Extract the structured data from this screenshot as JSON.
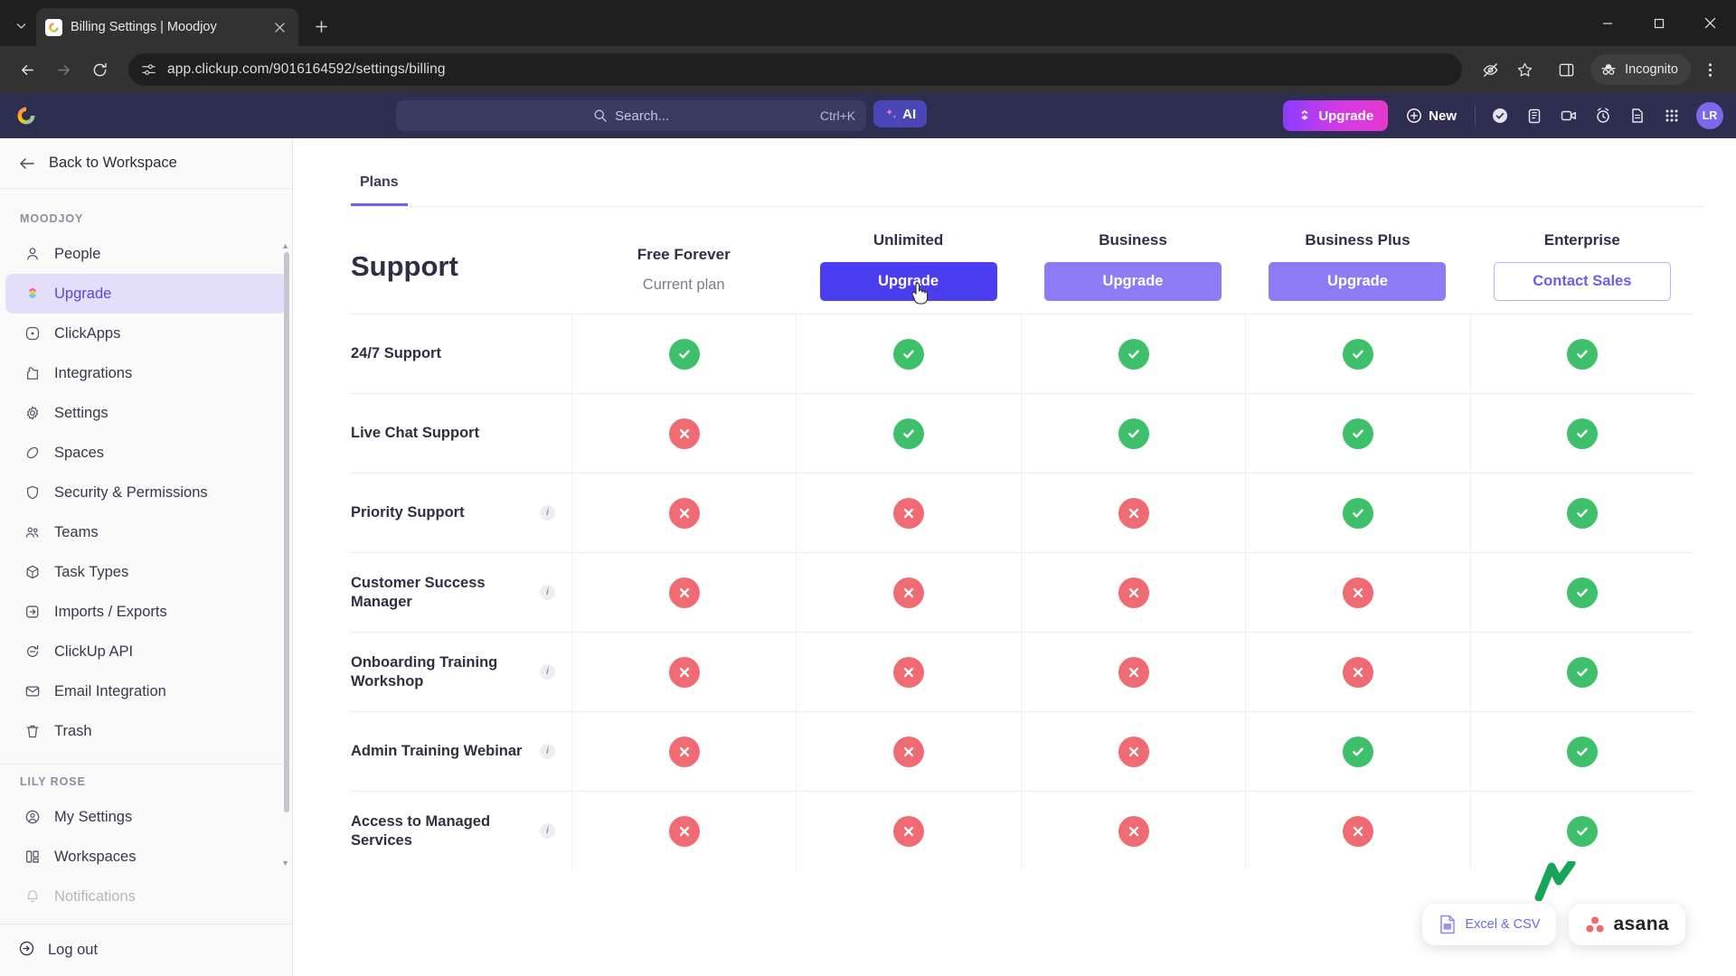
{
  "browser": {
    "tab": {
      "title": "Billing Settings | Moodjoy",
      "favicon_icon": "clickup-favicon",
      "close_icon": "close-icon"
    },
    "new_tab_label": "+",
    "tab_list_icon": "chevron-down-icon",
    "window": {
      "minimize": "minimize-icon",
      "maximize": "maximize-icon",
      "close": "close-icon"
    },
    "nav": {
      "back_icon": "arrow-left-icon",
      "forward_icon": "arrow-right-icon",
      "reload_icon": "reload-icon"
    },
    "omnibox": {
      "url": "app.clickup.com/9016164592/settings/billing",
      "site_info_icon": "page-settings-icon"
    },
    "actions": {
      "tracking_icon": "eye-off-icon",
      "bookmark_icon": "star-icon",
      "side_panel_icon": "side-panel-icon",
      "incognito_label": "Incognito",
      "incognito_icon": "incognito-hat-icon",
      "menu_icon": "kebab-menu-icon"
    }
  },
  "app_header": {
    "logo_icon": "clickup-logo-icon",
    "search": {
      "placeholder": "Search...",
      "shortcut": "Ctrl+K",
      "icon": "search-icon"
    },
    "ai_label": "AI",
    "ai_icon": "sparkle-icon",
    "upgrade_label": "Upgrade",
    "upgrade_icon": "rocket-upgrade-icon",
    "new_label": "New",
    "new_icon": "plus-circle-icon",
    "icons": [
      {
        "name": "check-circle-icon"
      },
      {
        "name": "clipboard-icon"
      },
      {
        "name": "video-camera-icon"
      },
      {
        "name": "alarm-clock-icon"
      },
      {
        "name": "document-icon"
      },
      {
        "name": "apps-grid-icon"
      }
    ],
    "avatar_initials": "LR"
  },
  "sidebar": {
    "back_label": "Back to Workspace",
    "back_icon": "arrow-left-icon",
    "group_workspace": "MOODJOY",
    "workspace_items": [
      {
        "label": "People",
        "icon": "person-icon",
        "active": false
      },
      {
        "label": "Upgrade",
        "icon": "rocket-upgrade-icon",
        "active": true
      },
      {
        "label": "ClickApps",
        "icon": "circle-dot-icon",
        "active": false
      },
      {
        "label": "Integrations",
        "icon": "puzzle-icon",
        "active": false
      },
      {
        "label": "Settings",
        "icon": "gear-icon",
        "active": false
      },
      {
        "label": "Spaces",
        "icon": "planet-icon",
        "active": false
      },
      {
        "label": "Security & Permissions",
        "icon": "shield-icon",
        "active": false
      },
      {
        "label": "Teams",
        "icon": "people-group-icon",
        "active": false
      },
      {
        "label": "Task Types",
        "icon": "cube-icon",
        "active": false
      },
      {
        "label": "Imports / Exports",
        "icon": "import-export-icon",
        "active": false
      },
      {
        "label": "ClickUp API",
        "icon": "api-refresh-icon",
        "active": false
      },
      {
        "label": "Email Integration",
        "icon": "envelope-icon",
        "active": false
      },
      {
        "label": "Trash",
        "icon": "trash-icon",
        "active": false
      }
    ],
    "group_user": "LILY ROSE",
    "user_items": [
      {
        "label": "My Settings",
        "icon": "user-circle-icon",
        "active": false
      },
      {
        "label": "Workspaces",
        "icon": "workspaces-icon",
        "active": false
      },
      {
        "label": "Notifications",
        "icon": "bell-icon",
        "active": false
      }
    ],
    "logout_label": "Log out",
    "logout_icon": "logout-icon",
    "scrollbar_icon": "scrollbar-thumb"
  },
  "main": {
    "tab_label": "Plans",
    "section_title": "Support",
    "plans": [
      {
        "name": "Free Forever",
        "cta": "Current plan",
        "cta_type": "current"
      },
      {
        "name": "Unlimited",
        "cta": "Upgrade",
        "cta_type": "primary"
      },
      {
        "name": "Business",
        "cta": "Upgrade",
        "cta_type": "secondary"
      },
      {
        "name": "Business Plus",
        "cta": "Upgrade",
        "cta_type": "secondary"
      },
      {
        "name": "Enterprise",
        "cta": "Contact Sales",
        "cta_type": "outline"
      }
    ],
    "features": [
      {
        "name": "24/7 Support",
        "info": false,
        "values": [
          true,
          true,
          true,
          true,
          true
        ]
      },
      {
        "name": "Live Chat Support",
        "info": false,
        "values": [
          false,
          true,
          true,
          true,
          true
        ]
      },
      {
        "name": "Priority Support",
        "info": true,
        "values": [
          false,
          false,
          false,
          true,
          true
        ]
      },
      {
        "name": "Customer Success Manager",
        "info": true,
        "values": [
          false,
          false,
          false,
          false,
          true
        ]
      },
      {
        "name": "Onboarding Training Workshop",
        "info": true,
        "values": [
          false,
          false,
          false,
          false,
          true
        ]
      },
      {
        "name": "Admin Training Webinar",
        "info": true,
        "values": [
          false,
          false,
          false,
          true,
          true
        ]
      },
      {
        "name": "Access to Managed Services",
        "info": true,
        "values": [
          false,
          false,
          false,
          false,
          true
        ]
      }
    ],
    "info_icon": "info-icon",
    "yes_icon": "check-circle-icon",
    "no_icon": "x-circle-icon",
    "cursor_icon": "pointer-hand-cursor"
  },
  "floating_chips": [
    {
      "label": "Excel & CSV",
      "icon": "excel-csv-file-icon",
      "style": "light"
    },
    {
      "label": "asana",
      "icon": "asana-logo-icon",
      "style": "dark"
    }
  ],
  "colors": {
    "accent_purple": "#7b5cf0",
    "primary_button": "#4b3ef0",
    "secondary_button": "#8b7cf5",
    "yes_green": "#3ec06a",
    "no_red": "#ef6a72",
    "app_header": "#2e2e50"
  }
}
